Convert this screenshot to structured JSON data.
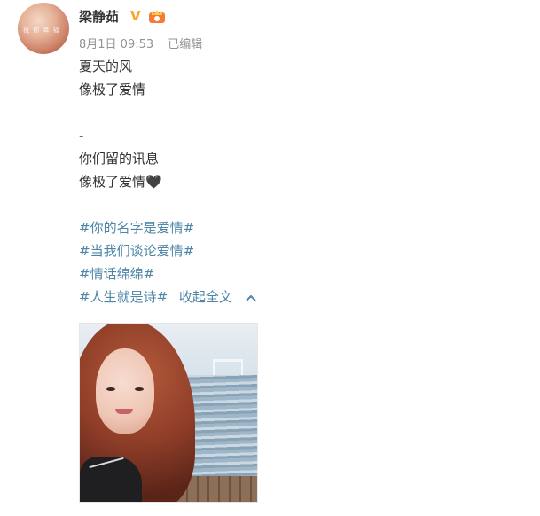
{
  "user": {
    "name": "梁静茹",
    "avatar_text": "祝 你 幸 福"
  },
  "meta": {
    "date": "8月1日 09:53",
    "edited": "已编辑"
  },
  "post": {
    "lines": [
      "夏天的风",
      "像极了爱情",
      "-",
      "你们留的讯息",
      "像极了爱情🖤"
    ],
    "tags": [
      "#你的名字是爱情#",
      "#当我们谈论爱情#",
      "#情话绵绵#",
      "#人生就是诗#"
    ],
    "collapse_label": "收起全文"
  },
  "colors": {
    "link": "#4e86a7",
    "meta": "#939393",
    "verified": "#f5a623"
  },
  "icons": {
    "verified": "verified-v-icon",
    "vip": "vip-crown-icon",
    "collapse": "chevron-up-icon"
  }
}
